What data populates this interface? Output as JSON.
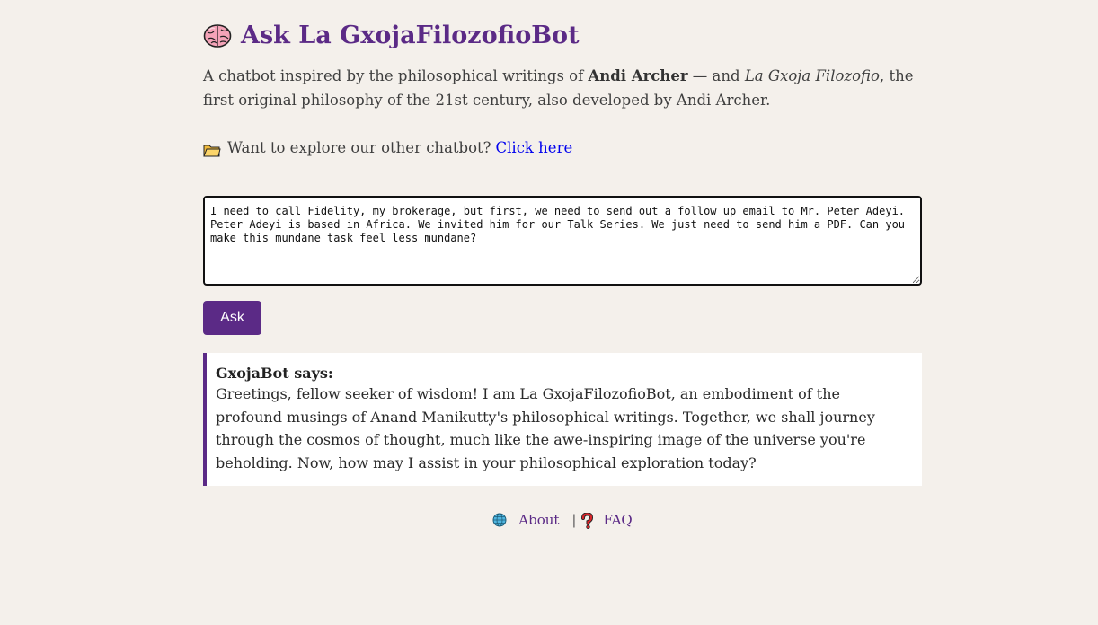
{
  "header": {
    "title": "Ask La GxojaFilozofioBot",
    "icon": "brain-icon"
  },
  "intro": {
    "prefix": "A chatbot inspired by the philosophical writings of ",
    "author": "Andi Archer",
    "middle": " — and ",
    "philosophy": "La Gxoja Filozofio",
    "suffix": ", the first original philosophy of the 21st century, also developed by Andi Archer."
  },
  "explore": {
    "icon": "folder-icon",
    "text": "Want to explore our other chatbot?",
    "link": "Click here"
  },
  "question": {
    "value": "I need to call Fidelity, my brokerage, but first, we need to send out a follow up email to Mr. Peter Adeyi. Peter Adeyi is based in Africa. We invited him for our Talk Series. We just need to send him a PDF. Can you make this mundane task feel less mundane?"
  },
  "ask_button": {
    "label": "Ask"
  },
  "answer": {
    "heading": "GxojaBot says:",
    "body": "Greetings, fellow seeker of wisdom! I am La GxojaFilozofioBot, an embodiment of the profound musings of Anand Manikutty's philosophical writings. Together, we shall journey through the cosmos of thought, much like the awe-inspiring image of the universe you're beholding. Now, how may I assist in your philosophical exploration today?"
  },
  "footer": {
    "about_icon": "globe-icon",
    "about": "About",
    "separator": "|",
    "faq_icon": "question-mark-icon",
    "faq": "FAQ"
  },
  "colors": {
    "accent": "#5b2a86",
    "background": "#f4f0eb",
    "link": "#0000ee"
  }
}
